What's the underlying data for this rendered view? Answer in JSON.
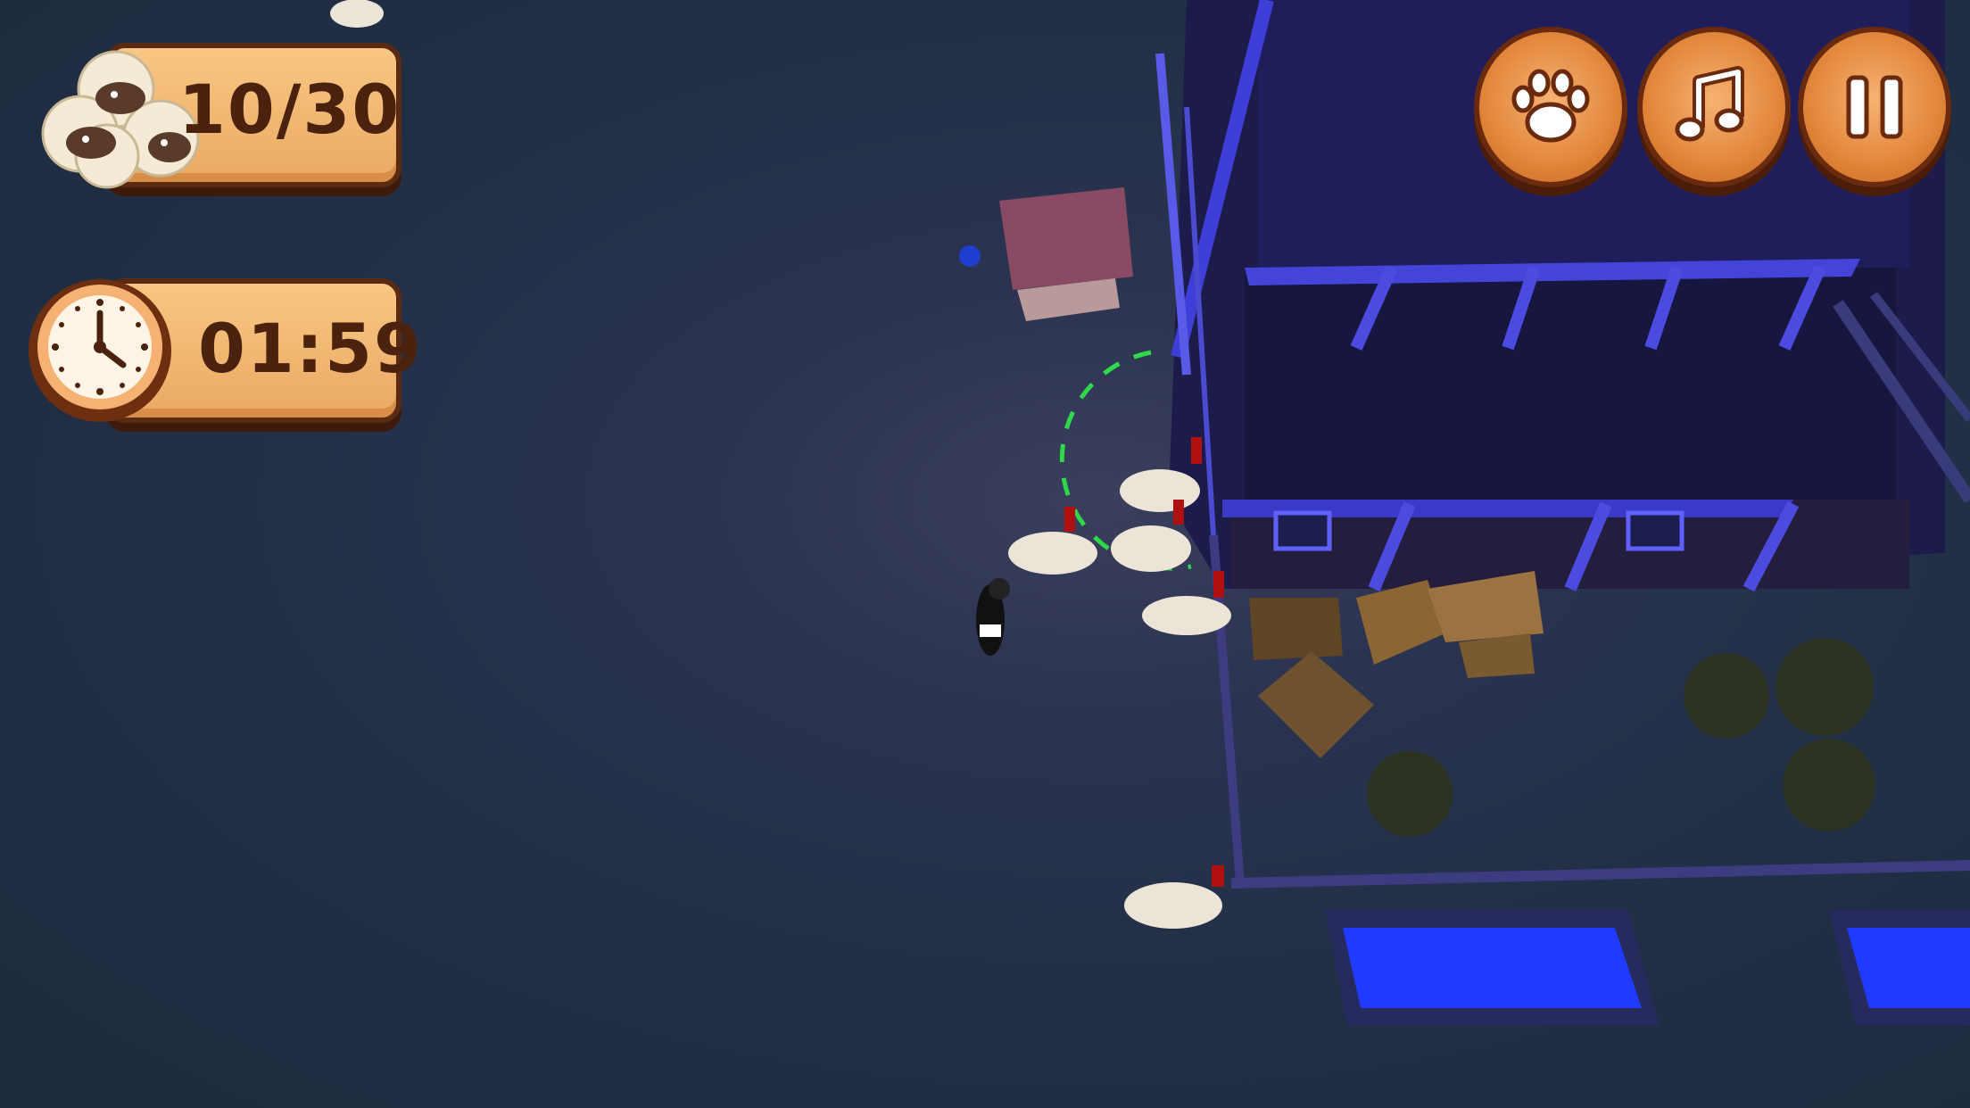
{
  "hud": {
    "sheep_counter": "10/30",
    "timer": "01:59"
  },
  "icons": {
    "sheep": "sheep-flock-icon",
    "clock": "clock-icon",
    "paw": "paw-icon",
    "music": "music-note-icon",
    "pause": "pause-icon"
  },
  "colors": {
    "hud_fill": "#f0b46f",
    "hud_border": "#5a2a12",
    "button_fill": "#e48a3f",
    "night_ground": "#223047",
    "barn_blue": "#3b3ccf",
    "water_blue": "#1f3bff"
  }
}
